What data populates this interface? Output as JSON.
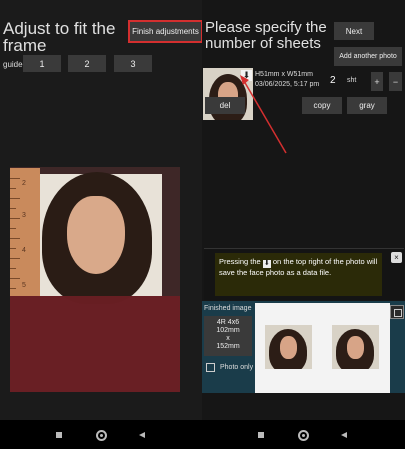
{
  "left_panel": {
    "title": "Adjust to fit the frame",
    "finish_button": "Finish adjustments",
    "guide_label": "guide",
    "guide_buttons": [
      "1",
      "2",
      "3"
    ],
    "ruler_marks": [
      "2",
      "3",
      "4",
      "5"
    ]
  },
  "right_panel": {
    "title": "Please specify the number of sheets",
    "next_button": "Next",
    "add_photo_button": "Add another photo",
    "photo_item": {
      "size": "H51mm x W51mm",
      "date": "03/06/2025, 5:17 pm",
      "count": "2",
      "unit": "sht",
      "plus": "+",
      "minus": "−",
      "download_icon": "download-icon"
    },
    "actions": [
      "del",
      "copy",
      "gray"
    ],
    "tip": {
      "before": "Pressing the",
      "after": "on the top right of the photo will save the face photo as a data file.",
      "close": "×"
    },
    "finished": {
      "label": "Finished image",
      "paper_lines": [
        "4R 4x6",
        "102mm",
        "x",
        "152mm"
      ],
      "photo_only": "Photo only"
    }
  },
  "colors": {
    "accent_red": "#d32f2f",
    "panel_bg": "#1b1b1b",
    "button_bg": "#3a3a3a",
    "finished_bg": "#1a3c4a",
    "tip_bg": "#2b2a08"
  }
}
